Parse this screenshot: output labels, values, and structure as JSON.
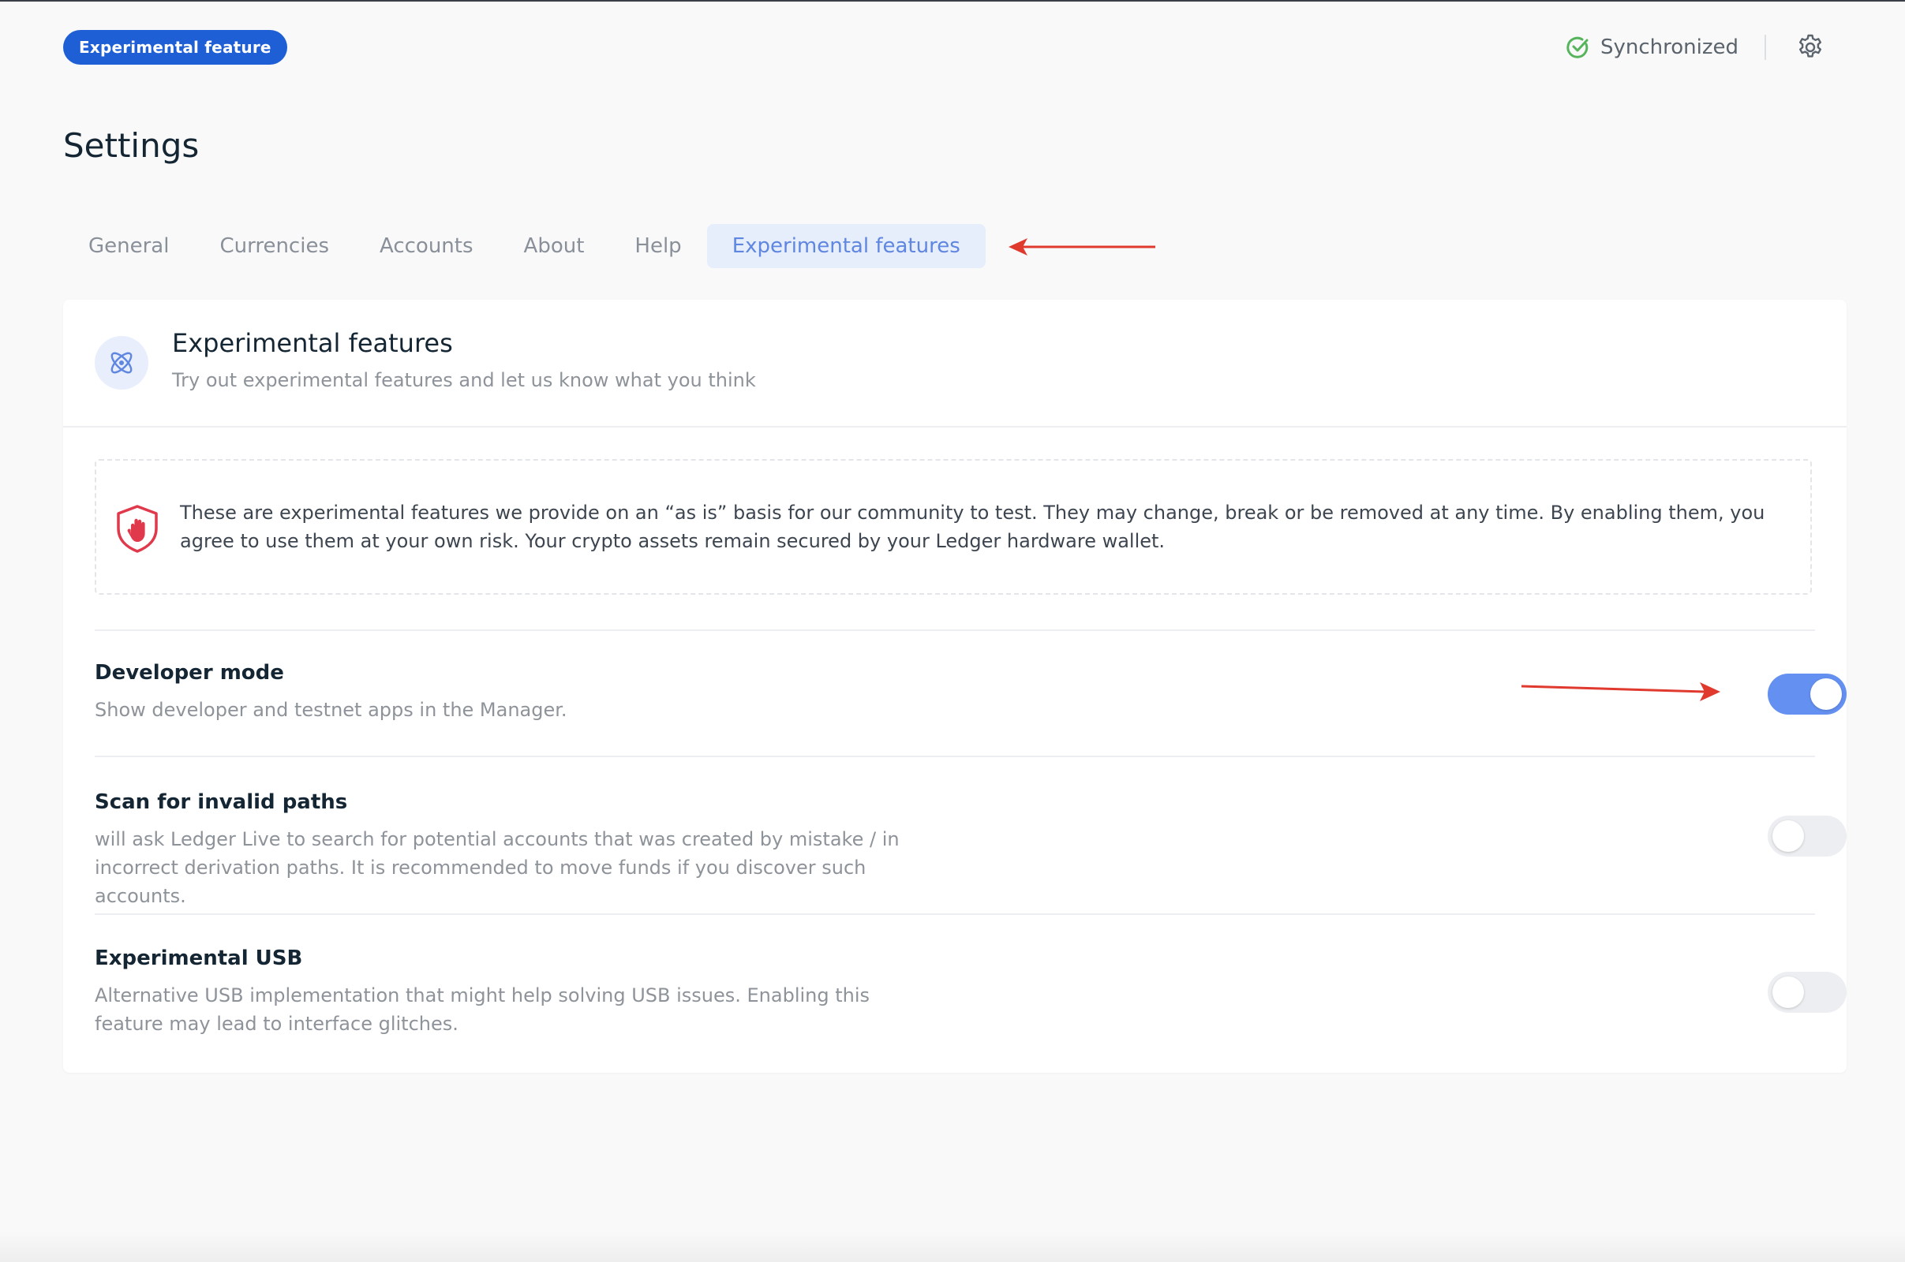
{
  "header": {
    "badge": "Experimental feature",
    "sync_status": "Synchronized",
    "icons": {
      "sync": "check-circle-icon",
      "settings": "gear-icon"
    },
    "colors": {
      "badge": "#1f5fd6",
      "sync": "#56b45c"
    }
  },
  "page": {
    "title": "Settings"
  },
  "tabs": [
    {
      "label": "General",
      "active": false
    },
    {
      "label": "Currencies",
      "active": false
    },
    {
      "label": "Accounts",
      "active": false
    },
    {
      "label": "About",
      "active": false
    },
    {
      "label": "Help",
      "active": false
    },
    {
      "label": "Experimental features",
      "active": true
    }
  ],
  "card": {
    "title": "Experimental features",
    "subtitle": "Try out experimental features and let us know what you think",
    "icon": "atom-icon",
    "warning": {
      "icon": "shield-hand-icon",
      "text": "These are experimental features we provide on an “as is” basis for our community to test. They may change, break or be removed at any time. By enabling them, you agree to use them at your own risk. Your crypto assets remain secured by your Ledger hardware wallet."
    },
    "settings": [
      {
        "title": "Developer mode",
        "description": "Show developer and testnet apps in the Manager.",
        "enabled": true
      },
      {
        "title": "Scan for invalid paths",
        "description": "will ask Ledger Live to search for potential accounts that was created by mistake / in incorrect derivation paths. It is recommended to move funds if you discover such accounts.",
        "enabled": false
      },
      {
        "title": "Experimental USB",
        "description": "Alternative USB implementation that might help solving USB issues. Enabling this feature may lead to interface glitches.",
        "enabled": false
      }
    ]
  },
  "annotations": {
    "arrow_color": "#e03a2f"
  },
  "colors": {
    "accent": "#6490f1",
    "tab_active_bg": "#e6edfb",
    "tab_active_text": "#5f86e0"
  }
}
